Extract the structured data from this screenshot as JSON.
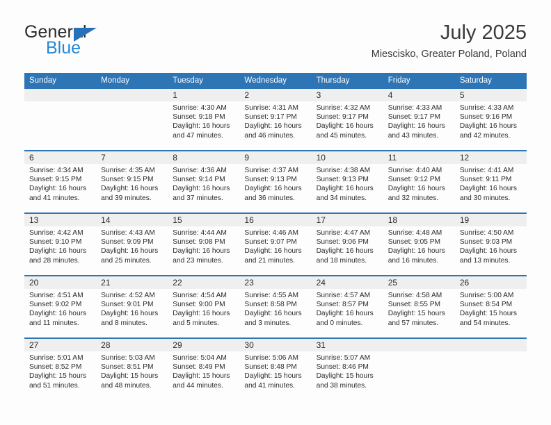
{
  "brand": {
    "name_top": "General",
    "name_bottom": "Blue",
    "triangle_color": "#2671b8",
    "blue_color": "#2488d6"
  },
  "header": {
    "title": "July 2025",
    "location": "Miescisko, Greater Poland, Poland"
  },
  "colors": {
    "header_blue": "#2e75b6",
    "daynum_band": "#efefef",
    "page_background": "#fdfdfd",
    "text": "#2b2b2b"
  },
  "weekday_headers": [
    "Sunday",
    "Monday",
    "Tuesday",
    "Wednesday",
    "Thursday",
    "Friday",
    "Saturday"
  ],
  "weeks": [
    [
      {
        "day": "",
        "empty": true
      },
      {
        "day": "",
        "empty": true
      },
      {
        "day": "1",
        "sunrise": "Sunrise: 4:30 AM",
        "sunset": "Sunset: 9:18 PM",
        "daylight": "Daylight: 16 hours and 47 minutes."
      },
      {
        "day": "2",
        "sunrise": "Sunrise: 4:31 AM",
        "sunset": "Sunset: 9:17 PM",
        "daylight": "Daylight: 16 hours and 46 minutes."
      },
      {
        "day": "3",
        "sunrise": "Sunrise: 4:32 AM",
        "sunset": "Sunset: 9:17 PM",
        "daylight": "Daylight: 16 hours and 45 minutes."
      },
      {
        "day": "4",
        "sunrise": "Sunrise: 4:33 AM",
        "sunset": "Sunset: 9:17 PM",
        "daylight": "Daylight: 16 hours and 43 minutes."
      },
      {
        "day": "5",
        "sunrise": "Sunrise: 4:33 AM",
        "sunset": "Sunset: 9:16 PM",
        "daylight": "Daylight: 16 hours and 42 minutes."
      }
    ],
    [
      {
        "day": "6",
        "sunrise": "Sunrise: 4:34 AM",
        "sunset": "Sunset: 9:15 PM",
        "daylight": "Daylight: 16 hours and 41 minutes."
      },
      {
        "day": "7",
        "sunrise": "Sunrise: 4:35 AM",
        "sunset": "Sunset: 9:15 PM",
        "daylight": "Daylight: 16 hours and 39 minutes."
      },
      {
        "day": "8",
        "sunrise": "Sunrise: 4:36 AM",
        "sunset": "Sunset: 9:14 PM",
        "daylight": "Daylight: 16 hours and 37 minutes."
      },
      {
        "day": "9",
        "sunrise": "Sunrise: 4:37 AM",
        "sunset": "Sunset: 9:13 PM",
        "daylight": "Daylight: 16 hours and 36 minutes."
      },
      {
        "day": "10",
        "sunrise": "Sunrise: 4:38 AM",
        "sunset": "Sunset: 9:13 PM",
        "daylight": "Daylight: 16 hours and 34 minutes."
      },
      {
        "day": "11",
        "sunrise": "Sunrise: 4:40 AM",
        "sunset": "Sunset: 9:12 PM",
        "daylight": "Daylight: 16 hours and 32 minutes."
      },
      {
        "day": "12",
        "sunrise": "Sunrise: 4:41 AM",
        "sunset": "Sunset: 9:11 PM",
        "daylight": "Daylight: 16 hours and 30 minutes."
      }
    ],
    [
      {
        "day": "13",
        "sunrise": "Sunrise: 4:42 AM",
        "sunset": "Sunset: 9:10 PM",
        "daylight": "Daylight: 16 hours and 28 minutes."
      },
      {
        "day": "14",
        "sunrise": "Sunrise: 4:43 AM",
        "sunset": "Sunset: 9:09 PM",
        "daylight": "Daylight: 16 hours and 25 minutes."
      },
      {
        "day": "15",
        "sunrise": "Sunrise: 4:44 AM",
        "sunset": "Sunset: 9:08 PM",
        "daylight": "Daylight: 16 hours and 23 minutes."
      },
      {
        "day": "16",
        "sunrise": "Sunrise: 4:46 AM",
        "sunset": "Sunset: 9:07 PM",
        "daylight": "Daylight: 16 hours and 21 minutes."
      },
      {
        "day": "17",
        "sunrise": "Sunrise: 4:47 AM",
        "sunset": "Sunset: 9:06 PM",
        "daylight": "Daylight: 16 hours and 18 minutes."
      },
      {
        "day": "18",
        "sunrise": "Sunrise: 4:48 AM",
        "sunset": "Sunset: 9:05 PM",
        "daylight": "Daylight: 16 hours and 16 minutes."
      },
      {
        "day": "19",
        "sunrise": "Sunrise: 4:50 AM",
        "sunset": "Sunset: 9:03 PM",
        "daylight": "Daylight: 16 hours and 13 minutes."
      }
    ],
    [
      {
        "day": "20",
        "sunrise": "Sunrise: 4:51 AM",
        "sunset": "Sunset: 9:02 PM",
        "daylight": "Daylight: 16 hours and 11 minutes."
      },
      {
        "day": "21",
        "sunrise": "Sunrise: 4:52 AM",
        "sunset": "Sunset: 9:01 PM",
        "daylight": "Daylight: 16 hours and 8 minutes."
      },
      {
        "day": "22",
        "sunrise": "Sunrise: 4:54 AM",
        "sunset": "Sunset: 9:00 PM",
        "daylight": "Daylight: 16 hours and 5 minutes."
      },
      {
        "day": "23",
        "sunrise": "Sunrise: 4:55 AM",
        "sunset": "Sunset: 8:58 PM",
        "daylight": "Daylight: 16 hours and 3 minutes."
      },
      {
        "day": "24",
        "sunrise": "Sunrise: 4:57 AM",
        "sunset": "Sunset: 8:57 PM",
        "daylight": "Daylight: 16 hours and 0 minutes."
      },
      {
        "day": "25",
        "sunrise": "Sunrise: 4:58 AM",
        "sunset": "Sunset: 8:55 PM",
        "daylight": "Daylight: 15 hours and 57 minutes."
      },
      {
        "day": "26",
        "sunrise": "Sunrise: 5:00 AM",
        "sunset": "Sunset: 8:54 PM",
        "daylight": "Daylight: 15 hours and 54 minutes."
      }
    ],
    [
      {
        "day": "27",
        "sunrise": "Sunrise: 5:01 AM",
        "sunset": "Sunset: 8:52 PM",
        "daylight": "Daylight: 15 hours and 51 minutes."
      },
      {
        "day": "28",
        "sunrise": "Sunrise: 5:03 AM",
        "sunset": "Sunset: 8:51 PM",
        "daylight": "Daylight: 15 hours and 48 minutes."
      },
      {
        "day": "29",
        "sunrise": "Sunrise: 5:04 AM",
        "sunset": "Sunset: 8:49 PM",
        "daylight": "Daylight: 15 hours and 44 minutes."
      },
      {
        "day": "30",
        "sunrise": "Sunrise: 5:06 AM",
        "sunset": "Sunset: 8:48 PM",
        "daylight": "Daylight: 15 hours and 41 minutes."
      },
      {
        "day": "31",
        "sunrise": "Sunrise: 5:07 AM",
        "sunset": "Sunset: 8:46 PM",
        "daylight": "Daylight: 15 hours and 38 minutes."
      },
      {
        "day": "",
        "empty": true
      },
      {
        "day": "",
        "empty": true
      }
    ]
  ]
}
